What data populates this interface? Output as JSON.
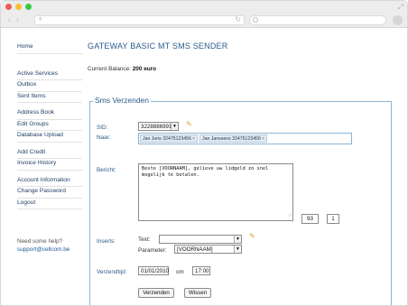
{
  "sidebar": {
    "items": [
      {
        "label": "Home"
      },
      {
        "label": "Active Services"
      },
      {
        "label": "Outbox"
      },
      {
        "label": "Sent Items"
      },
      {
        "label": "Address Book"
      },
      {
        "label": "Edit Groups"
      },
      {
        "label": "Database Upload"
      },
      {
        "label": "Add Credit"
      },
      {
        "label": "Invoice History"
      },
      {
        "label": "Account Information"
      },
      {
        "label": "Change Password"
      },
      {
        "label": "Logout"
      }
    ],
    "help_text": "Need some help?",
    "help_email": "support@cellcom.be"
  },
  "main": {
    "title": "GATEWAY BASIC MT SMS SENDER",
    "balance_label": "Current Balance:",
    "balance_value": "200 euro"
  },
  "form": {
    "legend": "Sms Verzenden",
    "sid_label": "SID:",
    "sid_value": "3228886991",
    "naar_label": "Naar:",
    "recipients": [
      {
        "text": "Jan Joris 32475123456"
      },
      {
        "text": "Jan Janssens 32475123456"
      }
    ],
    "remove_symbol": "×",
    "bericht_label": "Bericht:",
    "bericht_value": "Beste [VOORNAAM], gelieve uw lidgeld zo snel\nmogelijk te betalen.",
    "char_count": "93",
    "sms_count": "1",
    "inserts_label": "Inserts:",
    "text_label": "Text:",
    "text_value": "",
    "parameter_label": "Parameter:",
    "parameter_value": "[VOORNAAM]",
    "verzendtijd_label": "Verzendtijd:",
    "date_value": "01/01/2010",
    "om_label": "om",
    "time_value": "17:00",
    "send_button": "Verzenden",
    "clear_button": "Wissen"
  },
  "colors": {
    "link": "#1e3f66",
    "title": "#2a5a8a",
    "border": "#8fb2d2"
  },
  "icons": {
    "edit": "pencil-icon",
    "dropdown": "chevron-down-icon"
  }
}
